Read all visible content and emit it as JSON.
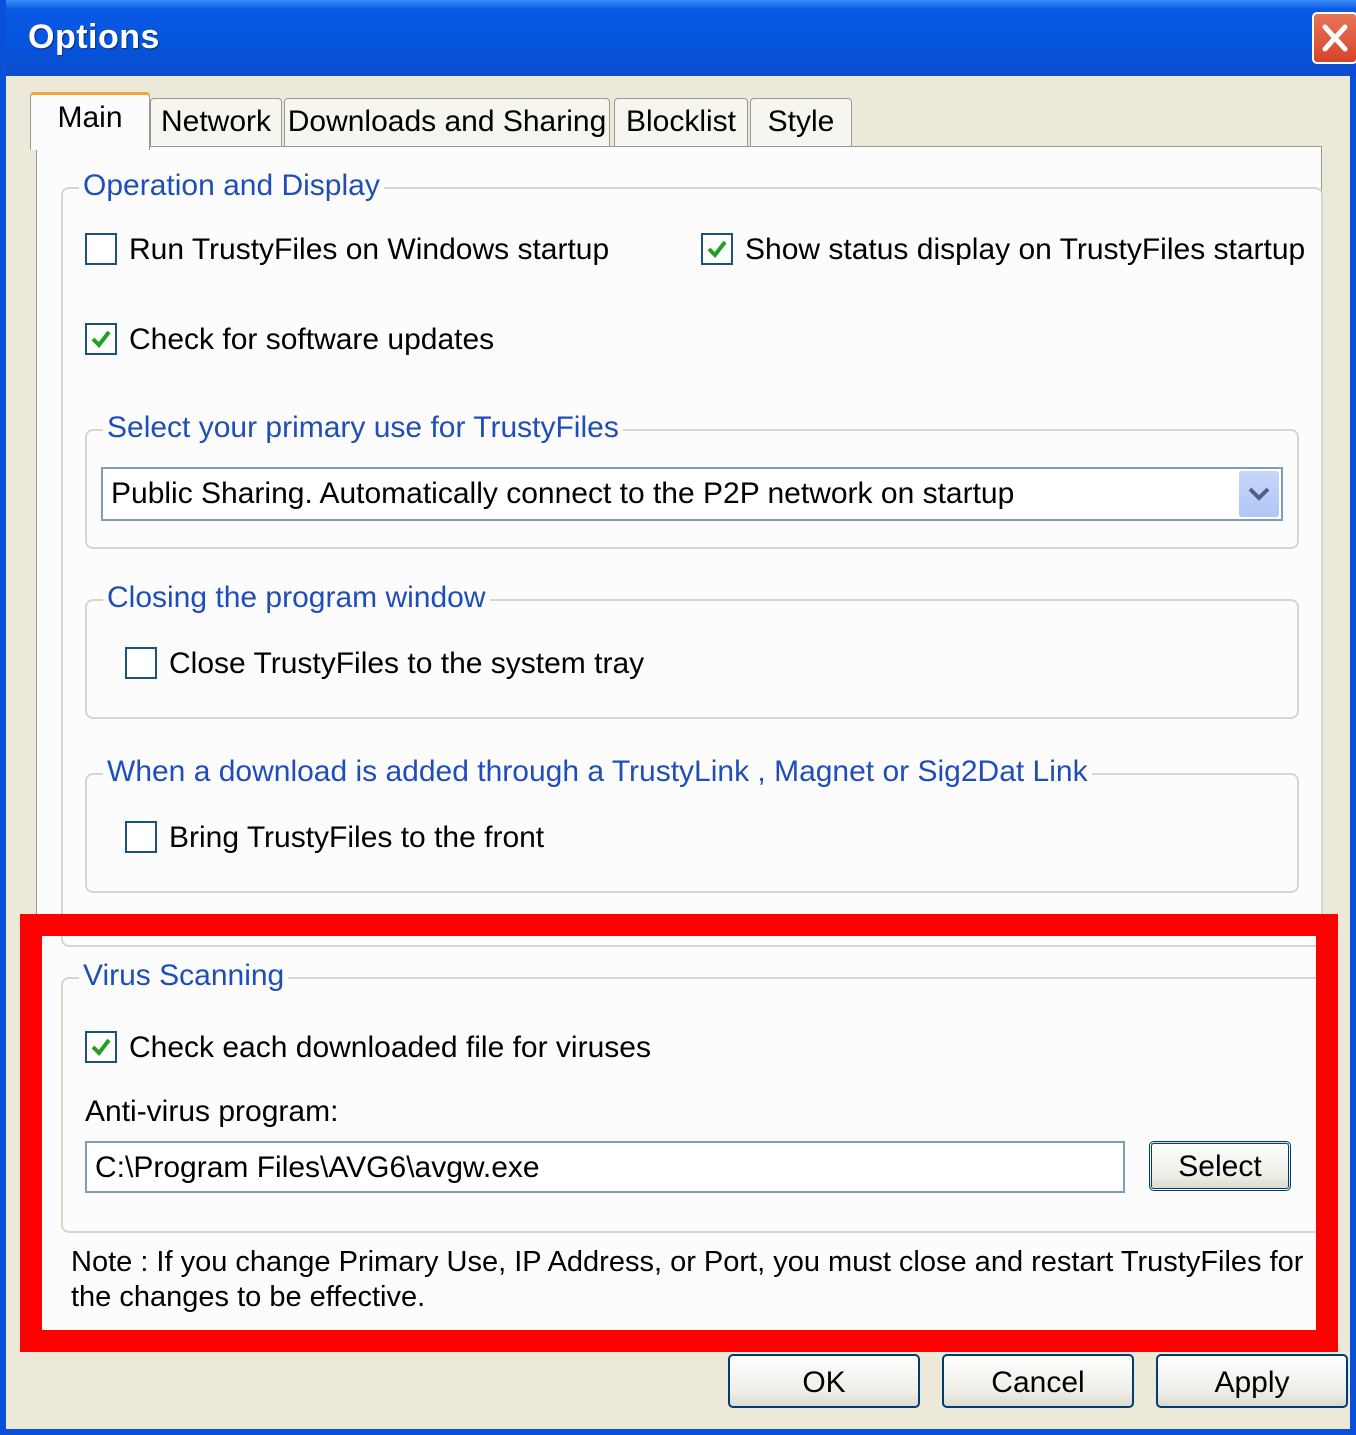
{
  "window": {
    "title": "Options"
  },
  "tabs": [
    {
      "label": "Main"
    },
    {
      "label": "Network"
    },
    {
      "label": "Downloads and Sharing"
    },
    {
      "label": "Blocklist"
    },
    {
      "label": "Style"
    }
  ],
  "operation_display": {
    "legend": "Operation and Display",
    "run_on_startup": {
      "label": "Run TrustyFiles on Windows startup",
      "checked": false
    },
    "show_status": {
      "label": "Show status display on TrustyFiles startup",
      "checked": true
    },
    "check_updates": {
      "label": "Check for software updates",
      "checked": true
    }
  },
  "primary_use": {
    "legend": "Select your primary use for TrustyFiles",
    "selected": "Public Sharing.  Automatically connect to the P2P network on startup"
  },
  "closing": {
    "legend": "Closing the program window",
    "close_to_tray": {
      "label": "Close TrustyFiles to the system tray",
      "checked": false
    }
  },
  "download_link": {
    "legend": "When a download is added through a TrustyLink , Magnet  or Sig2Dat Link",
    "bring_front": {
      "label": "Bring TrustyFiles to the front",
      "checked": false
    }
  },
  "virus": {
    "legend": "Virus Scanning",
    "check_each": {
      "label": "Check each downloaded file for viruses",
      "checked": true
    },
    "program_label": "Anti-virus program:",
    "program_path": "C:\\Program Files\\AVG6\\avgw.exe",
    "select_label": "Select"
  },
  "note": "Note : If you change Primary Use, IP Address, or Port, you must close and restart TrustyFiles for the changes to be effective.",
  "buttons": {
    "ok": "OK",
    "cancel": "Cancel",
    "apply": "Apply"
  },
  "colors": {
    "titlebar": "#0554dc",
    "legend_text": "#1f4dba",
    "highlight": "#ff0000",
    "check": "#21a121"
  }
}
